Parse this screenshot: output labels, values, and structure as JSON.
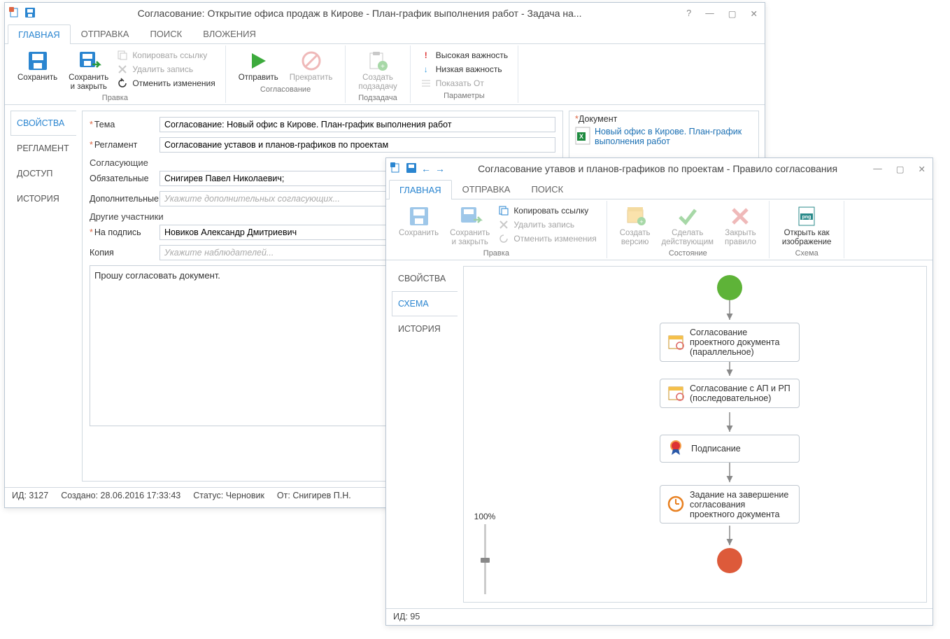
{
  "window1": {
    "title": "Согласование: Открытие офиса продаж в Кирове - План-график выполнения работ - Задача на...",
    "tabs": {
      "main": "ГЛАВНАЯ",
      "send": "ОТПРАВКА",
      "search": "ПОИСК",
      "attach": "ВЛОЖЕНИЯ"
    },
    "ribbon": {
      "save": "Сохранить",
      "save_close": "Сохранить\nи закрыть",
      "copy_link": "Копировать ссылку",
      "delete_record": "Удалить запись",
      "undo_changes": "Отменить изменения",
      "group_edit": "Правка",
      "send_btn": "Отправить",
      "stop_btn": "Прекратить",
      "group_approval": "Согласование",
      "create_subtask": "Создать\nподзадачу",
      "group_subtask": "Подзадача",
      "high_importance": "Высокая важность",
      "low_importance": "Низкая важность",
      "show_from": "Показать От",
      "group_params": "Параметры"
    },
    "side_tabs": {
      "props": "СВОЙСТВА",
      "reglament": "РЕГЛАМЕНТ",
      "access": "ДОСТУП",
      "history": "ИСТОРИЯ"
    },
    "form": {
      "topic_label": "Тема",
      "topic_value": "Согласование: Новый офис в Кирове. План-график выполнения работ",
      "reglament_label": "Регламент",
      "reglament_value": "Согласование уставов и планов-графиков по проектам",
      "approvers_label": "Согласующие",
      "mandatory_label": "Обязательные",
      "mandatory_value": "Снигирев Павел Николаевич;",
      "additional_label": "Дополнительные",
      "additional_placeholder": "Укажите дополнительных согласующих...",
      "others_label": "Другие участники",
      "signer_label": "На подпись",
      "signer_value": "Новиков Александр Дмитриевич",
      "copy_label": "Копия",
      "copy_placeholder": "Укажите наблюдателей...",
      "instruction": "Прошу согласовать документ."
    },
    "right": {
      "doc_label": "Документ",
      "doc_name": "Новый офис в Кирове. План-график выполнения работ"
    },
    "status": {
      "id": "ИД: 3127",
      "created": "Создано: 28.06.2016 17:33:43",
      "status": "Статус: Черновик",
      "from": "От: Снигирев П.Н."
    }
  },
  "window2": {
    "title": "Согласование утавов и планов-графиков по проектам - Правило согласования",
    "tabs": {
      "main": "ГЛАВНАЯ",
      "send": "ОТПРАВКА",
      "search": "ПОИСК"
    },
    "ribbon": {
      "save": "Сохранить",
      "save_close": "Сохранить\nи закрыть",
      "copy_link": "Копировать ссылку",
      "delete_record": "Удалить запись",
      "undo_changes": "Отменить изменения",
      "group_edit": "Правка",
      "create_version": "Создать\nверсию",
      "make_active": "Сделать\nдействующим",
      "close_rule": "Закрыть\nправило",
      "group_state": "Состояние",
      "open_as_image": "Открыть как\nизображение",
      "group_scheme": "Схема"
    },
    "side_tabs": {
      "props": "СВОЙСТВА",
      "scheme": "СХЕМА",
      "history": "ИСТОРИЯ"
    },
    "flow": {
      "node1": "Согласование проектного документа (параллельное)",
      "node2": "Согласование с АП и РП (последовательное)",
      "node3": "Подписание",
      "node4": "Задание на завершение согласования проектного документа"
    },
    "zoom": "100%",
    "status": {
      "id": "ИД: 95"
    }
  }
}
